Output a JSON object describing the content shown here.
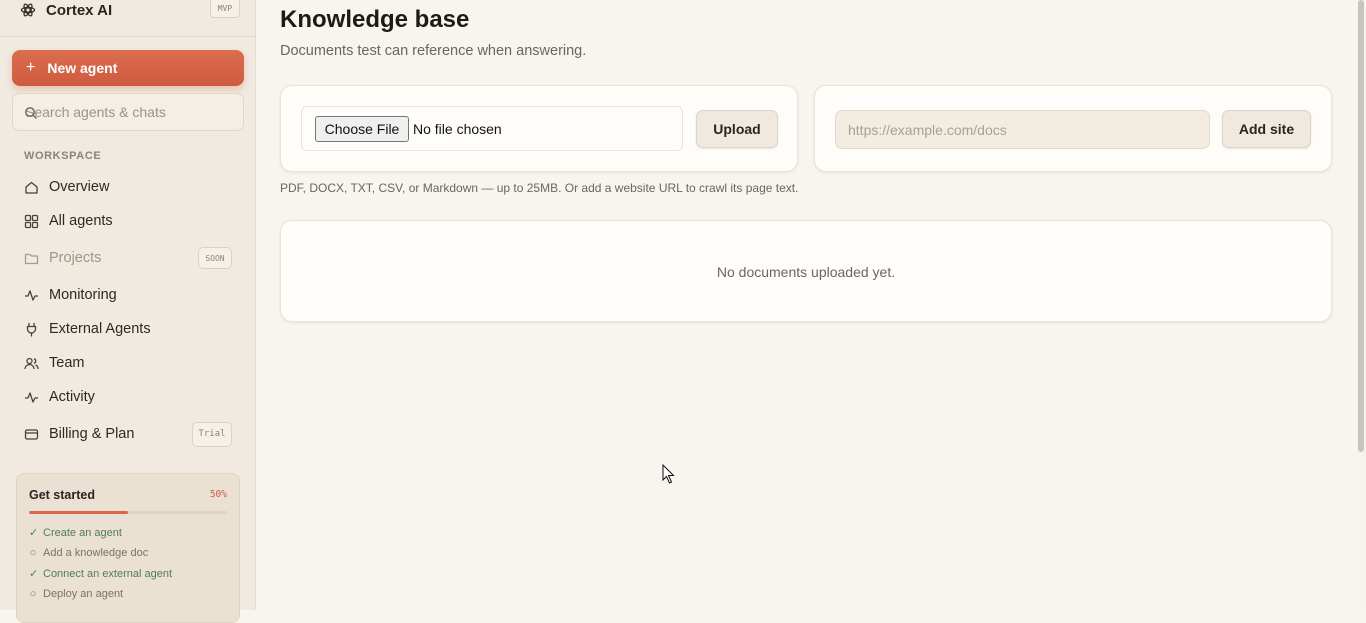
{
  "sidebar": {
    "brand": "Cortex AI",
    "brand_badge": "MVP",
    "new_agent_label": "New agent",
    "search_placeholder": "Search agents & chats",
    "section_label": "WORKSPACE",
    "items": [
      {
        "label": "Overview",
        "icon": "home-icon"
      },
      {
        "label": "All agents",
        "icon": "grid-icon"
      },
      {
        "label": "Projects",
        "icon": "folder-icon",
        "badge": "SOON",
        "disabled": true
      },
      {
        "label": "Monitoring",
        "icon": "pulse-icon"
      },
      {
        "label": "External Agents",
        "icon": "plug-icon"
      },
      {
        "label": "Team",
        "icon": "users-icon"
      },
      {
        "label": "Activity",
        "icon": "activity-icon"
      },
      {
        "label": "Billing & Plan",
        "icon": "credit-card-icon",
        "badge": "Trial"
      }
    ],
    "get_started": {
      "title": "Get started",
      "percent": "50%",
      "progress": 0.5,
      "steps": [
        {
          "label": "Create an agent",
          "done": true,
          "mark": "✓"
        },
        {
          "label": "Add a knowledge doc",
          "done": false,
          "mark": "○"
        },
        {
          "label": "Connect an external agent",
          "done": true,
          "mark": "✓"
        },
        {
          "label": "Deploy an agent",
          "done": false,
          "mark": "○"
        }
      ]
    }
  },
  "main": {
    "title": "Knowledge base",
    "subtitle": "Documents test can reference when answering.",
    "upload": {
      "choose_file_label": "Choose File",
      "file_status": "No file chosen",
      "upload_label": "Upload"
    },
    "url": {
      "placeholder": "https://example.com/docs",
      "add_label": "Add site"
    },
    "help_text": "PDF, DOCX, TXT, CSV, or Markdown — up to 25MB. Or add a website URL to crawl its page text.",
    "empty_state": "No documents uploaded yet."
  },
  "colors": {
    "accent": "#cf5b3f",
    "background": "#f8f4ee",
    "sidebar": "#f1eae0",
    "success": "#4f7d57"
  }
}
